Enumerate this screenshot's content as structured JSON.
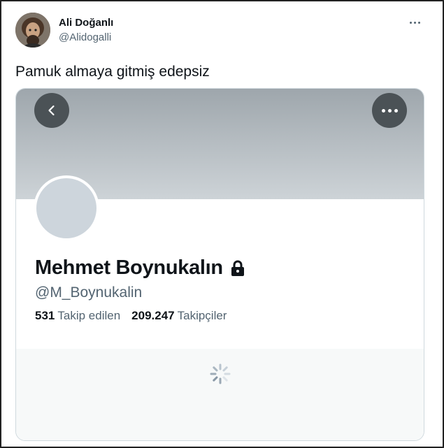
{
  "tweet": {
    "author_name": "Ali Doğanlı",
    "author_handle": "@Alidogalli",
    "text": "Pamuk almaya gitmiş edepsiz",
    "more_icon": "more-horizontal-icon"
  },
  "profile_card": {
    "name": "Mehmet Boynukalın",
    "handle": "@M_Boynukalin",
    "protected_icon": "lock-icon",
    "following_count": "531",
    "following_label": "Takip edilen",
    "followers_count": "209.247",
    "followers_label": "Takipçiler",
    "back_icon": "chevron-left-icon",
    "menu_icon": "more-horizontal-icon",
    "loading_icon": "spinner-icon"
  },
  "colors": {
    "primary_text": "#0f1419",
    "secondary_text": "#536471",
    "banner": "#b4bbc0",
    "overlay_button": "#4b5256"
  }
}
